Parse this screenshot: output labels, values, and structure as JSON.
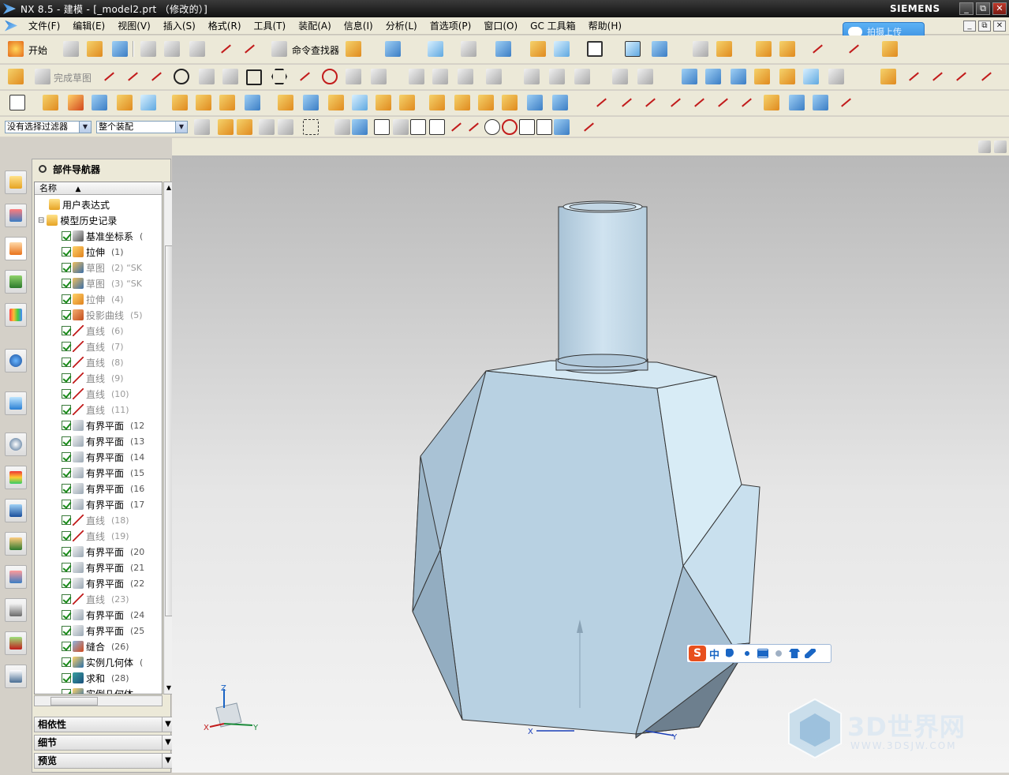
{
  "window": {
    "title": "NX 8.5 - 建模 - [_model2.prt （修改的）]",
    "brand": "SIEMENS",
    "controls": [
      "_",
      "⧉",
      "✕"
    ],
    "mdi_controls": [
      "_",
      "⧉",
      "✕"
    ]
  },
  "menubar": {
    "items": [
      "文件(F)",
      "编辑(E)",
      "视图(V)",
      "插入(S)",
      "格式(R)",
      "工具(T)",
      "装配(A)",
      "信息(I)",
      "分析(L)",
      "首选项(P)",
      "窗口(O)",
      "GC 工具箱",
      "帮助(H)"
    ]
  },
  "cloud_widget": {
    "label": "拍摄上传"
  },
  "toolbar1": {
    "start_label": "开始",
    "command_finder_label": "命令查找器"
  },
  "toolbar2": {
    "finish_sketch_label": "完成草图"
  },
  "selection_bar": {
    "filter_value": "没有选择过滤器",
    "scope_value": "整个装配"
  },
  "navigator": {
    "title": "部件导航器",
    "column_header": "名称",
    "items": [
      {
        "label": "用户表达式",
        "seq": "",
        "dim": false,
        "kind": "folder",
        "indent": 1,
        "checked": false
      },
      {
        "label": "模型历史记录",
        "seq": "",
        "dim": false,
        "kind": "folder",
        "indent": 0,
        "checked": false
      },
      {
        "label": "基准坐标系",
        "seq": "(",
        "dim": false,
        "kind": "datum",
        "indent": 2,
        "checked": true
      },
      {
        "label": "拉伸",
        "seq": "(1)",
        "dim": false,
        "kind": "extrude",
        "indent": 2,
        "checked": true
      },
      {
        "label": "草图",
        "seq": "(2) “SK",
        "dim": true,
        "kind": "sketch",
        "indent": 2,
        "checked": true
      },
      {
        "label": "草图",
        "seq": "(3) “SK",
        "dim": true,
        "kind": "sketch",
        "indent": 2,
        "checked": true
      },
      {
        "label": "拉伸",
        "seq": "(4)",
        "dim": true,
        "kind": "extrude",
        "indent": 2,
        "checked": true
      },
      {
        "label": "投影曲线",
        "seq": "(5)",
        "dim": true,
        "kind": "curve",
        "indent": 2,
        "checked": true
      },
      {
        "label": "直线",
        "seq": "(6)",
        "dim": true,
        "kind": "line",
        "indent": 2,
        "checked": true
      },
      {
        "label": "直线",
        "seq": "(7)",
        "dim": true,
        "kind": "line",
        "indent": 2,
        "checked": true
      },
      {
        "label": "直线",
        "seq": "(8)",
        "dim": true,
        "kind": "line",
        "indent": 2,
        "checked": true
      },
      {
        "label": "直线",
        "seq": "(9)",
        "dim": true,
        "kind": "line",
        "indent": 2,
        "checked": true
      },
      {
        "label": "直线",
        "seq": "(10)",
        "dim": true,
        "kind": "line",
        "indent": 2,
        "checked": true
      },
      {
        "label": "直线",
        "seq": "(11)",
        "dim": true,
        "kind": "line",
        "indent": 2,
        "checked": true
      },
      {
        "label": "有界平面",
        "seq": "(12",
        "dim": false,
        "kind": "plane",
        "indent": 2,
        "checked": true
      },
      {
        "label": "有界平面",
        "seq": "(13",
        "dim": false,
        "kind": "plane",
        "indent": 2,
        "checked": true
      },
      {
        "label": "有界平面",
        "seq": "(14",
        "dim": false,
        "kind": "plane",
        "indent": 2,
        "checked": true
      },
      {
        "label": "有界平面",
        "seq": "(15",
        "dim": false,
        "kind": "plane",
        "indent": 2,
        "checked": true
      },
      {
        "label": "有界平面",
        "seq": "(16",
        "dim": false,
        "kind": "plane",
        "indent": 2,
        "checked": true
      },
      {
        "label": "有界平面",
        "seq": "(17",
        "dim": false,
        "kind": "plane",
        "indent": 2,
        "checked": true
      },
      {
        "label": "直线",
        "seq": "(18)",
        "dim": true,
        "kind": "line",
        "indent": 2,
        "checked": true
      },
      {
        "label": "直线",
        "seq": "(19)",
        "dim": true,
        "kind": "line",
        "indent": 2,
        "checked": true
      },
      {
        "label": "有界平面",
        "seq": "(20",
        "dim": false,
        "kind": "plane",
        "indent": 2,
        "checked": true
      },
      {
        "label": "有界平面",
        "seq": "(21",
        "dim": false,
        "kind": "plane",
        "indent": 2,
        "checked": true
      },
      {
        "label": "有界平面",
        "seq": "(22",
        "dim": false,
        "kind": "plane",
        "indent": 2,
        "checked": true
      },
      {
        "label": "直线",
        "seq": "(23)",
        "dim": true,
        "kind": "line",
        "indent": 2,
        "checked": true
      },
      {
        "label": "有界平面",
        "seq": "(24",
        "dim": false,
        "kind": "plane",
        "indent": 2,
        "checked": true
      },
      {
        "label": "有界平面",
        "seq": "(25",
        "dim": false,
        "kind": "plane",
        "indent": 2,
        "checked": true
      },
      {
        "label": "缝合",
        "seq": "(26)",
        "dim": false,
        "kind": "sew",
        "indent": 2,
        "checked": true
      },
      {
        "label": "实例几何体",
        "seq": "(",
        "dim": false,
        "kind": "instance",
        "indent": 2,
        "checked": true
      },
      {
        "label": "求和",
        "seq": "(28)",
        "dim": false,
        "kind": "unite",
        "indent": 2,
        "checked": true
      },
      {
        "label": "实例几何体",
        "seq": "",
        "dim": false,
        "kind": "instance",
        "indent": 2,
        "checked": true
      }
    ],
    "sections": [
      "相依性",
      "细节",
      "预览"
    ]
  },
  "viewport": {
    "triad_axes": {
      "x": "X",
      "y": "Y",
      "z": "Z"
    },
    "wcs_axes": {
      "x": "X",
      "y": "Y"
    }
  },
  "ime_bar": {
    "logo": "S",
    "mode": "中"
  },
  "watermark": {
    "text": "3D世界网",
    "url": "WWW.3DSJW.COM"
  }
}
